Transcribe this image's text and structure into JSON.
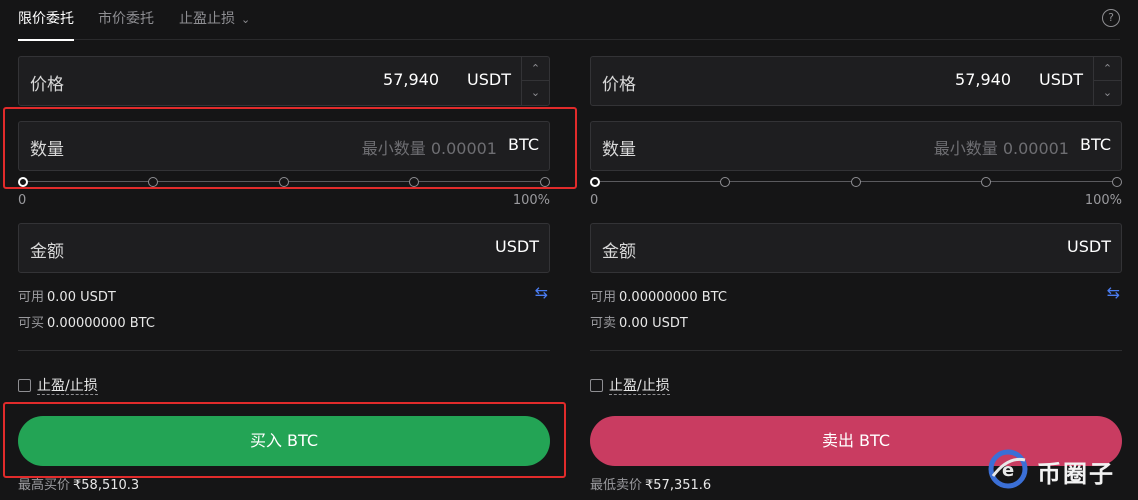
{
  "tabs": [
    {
      "label": "限价委托",
      "active": true
    },
    {
      "label": "市价委托",
      "active": false
    },
    {
      "label": "止盈止损",
      "active": false
    }
  ],
  "help_icon": "?",
  "buy": {
    "price_label": "价格",
    "price_value": "57,940",
    "price_unit": "USDT",
    "qty_label": "数量",
    "qty_placeholder": "最小数量 0.00001",
    "qty_unit": "BTC",
    "slider_min": "0",
    "slider_max": "100%",
    "slider_value": 0,
    "amount_label": "金额",
    "amount_unit": "USDT",
    "avail_label": "可用",
    "avail_value": "0.00 USDT",
    "can_label": "可买",
    "can_value": "0.00000000 BTC",
    "tp_label": "止盈/止损",
    "button": "买入 BTC",
    "best_label": "最高买价",
    "best_value": "₹58,510.3"
  },
  "sell": {
    "price_label": "价格",
    "price_value": "57,940",
    "price_unit": "USDT",
    "qty_label": "数量",
    "qty_placeholder": "最小数量 0.00001",
    "qty_unit": "BTC",
    "slider_min": "0",
    "slider_max": "100%",
    "slider_value": 0,
    "amount_label": "金额",
    "amount_unit": "USDT",
    "avail_label": "可用",
    "avail_value": "0.00000000 BTC",
    "can_label": "可卖",
    "can_value": "0.00 USDT",
    "tp_label": "止盈/止损",
    "button": "卖出 BTC",
    "best_label": "最低卖价",
    "best_value": "₹57,351.6"
  },
  "watermark": "币圈子",
  "colors": {
    "buy": "#23a455",
    "sell": "#c93c61",
    "highlight": "#e12b2b",
    "swap_icon": "#4a7cf0"
  },
  "icons": [
    "chevron-down-icon",
    "help-icon",
    "stepper-up-icon",
    "stepper-down-icon",
    "swap-icon",
    "checkbox-icon"
  ]
}
